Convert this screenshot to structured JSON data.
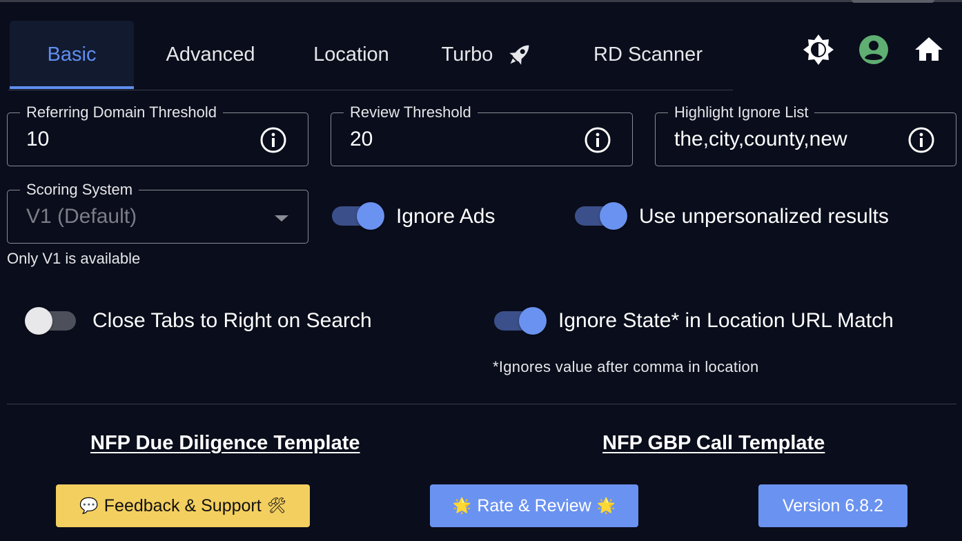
{
  "tabs": [
    {
      "label": "Basic"
    },
    {
      "label": "Advanced"
    },
    {
      "label": "Location"
    },
    {
      "label": "Turbo"
    },
    {
      "label": "RD Scanner"
    }
  ],
  "active_tab": "Basic",
  "header_icons": [
    "brightness-icon",
    "account-icon",
    "home-icon"
  ],
  "fields": {
    "referring_domain": {
      "label": "Referring Domain Threshold",
      "value": "10"
    },
    "review": {
      "label": "Review Threshold",
      "value": "20"
    },
    "highlight_ignore": {
      "label": "Highlight Ignore List",
      "value": "the,city,county,new"
    },
    "scoring": {
      "label": "Scoring System",
      "value": "V1 (Default)",
      "helper": "Only V1 is available"
    }
  },
  "toggles": {
    "ignore_ads": {
      "label": "Ignore Ads",
      "on": true
    },
    "unpersonalized": {
      "label": "Use unpersonalized results",
      "on": true
    },
    "close_tabs": {
      "label": "Close Tabs to Right on Search",
      "on": false
    },
    "ignore_state": {
      "label": "Ignore State* in Location URL Match",
      "on": true
    }
  },
  "footnote": "*Ignores value after comma in location",
  "links": {
    "due_diligence": "NFP Due Diligence Template",
    "gbp_call": "NFP GBP Call Template"
  },
  "buttons": {
    "feedback": {
      "label": "Feedback & Support",
      "emoji_left": "💬",
      "emoji_right": "🛠"
    },
    "rate": {
      "label": "Rate & Review",
      "emoji_left": "🌟",
      "emoji_right": "🌟"
    },
    "version": {
      "label": "Version 6.8.2"
    }
  },
  "colors": {
    "background": "#0a0d1b",
    "accent": "#6a92f0",
    "active_tab_text": "#5f8ff0",
    "feedback_button": "#f3cf5f",
    "account_icon": "#5fae72"
  }
}
